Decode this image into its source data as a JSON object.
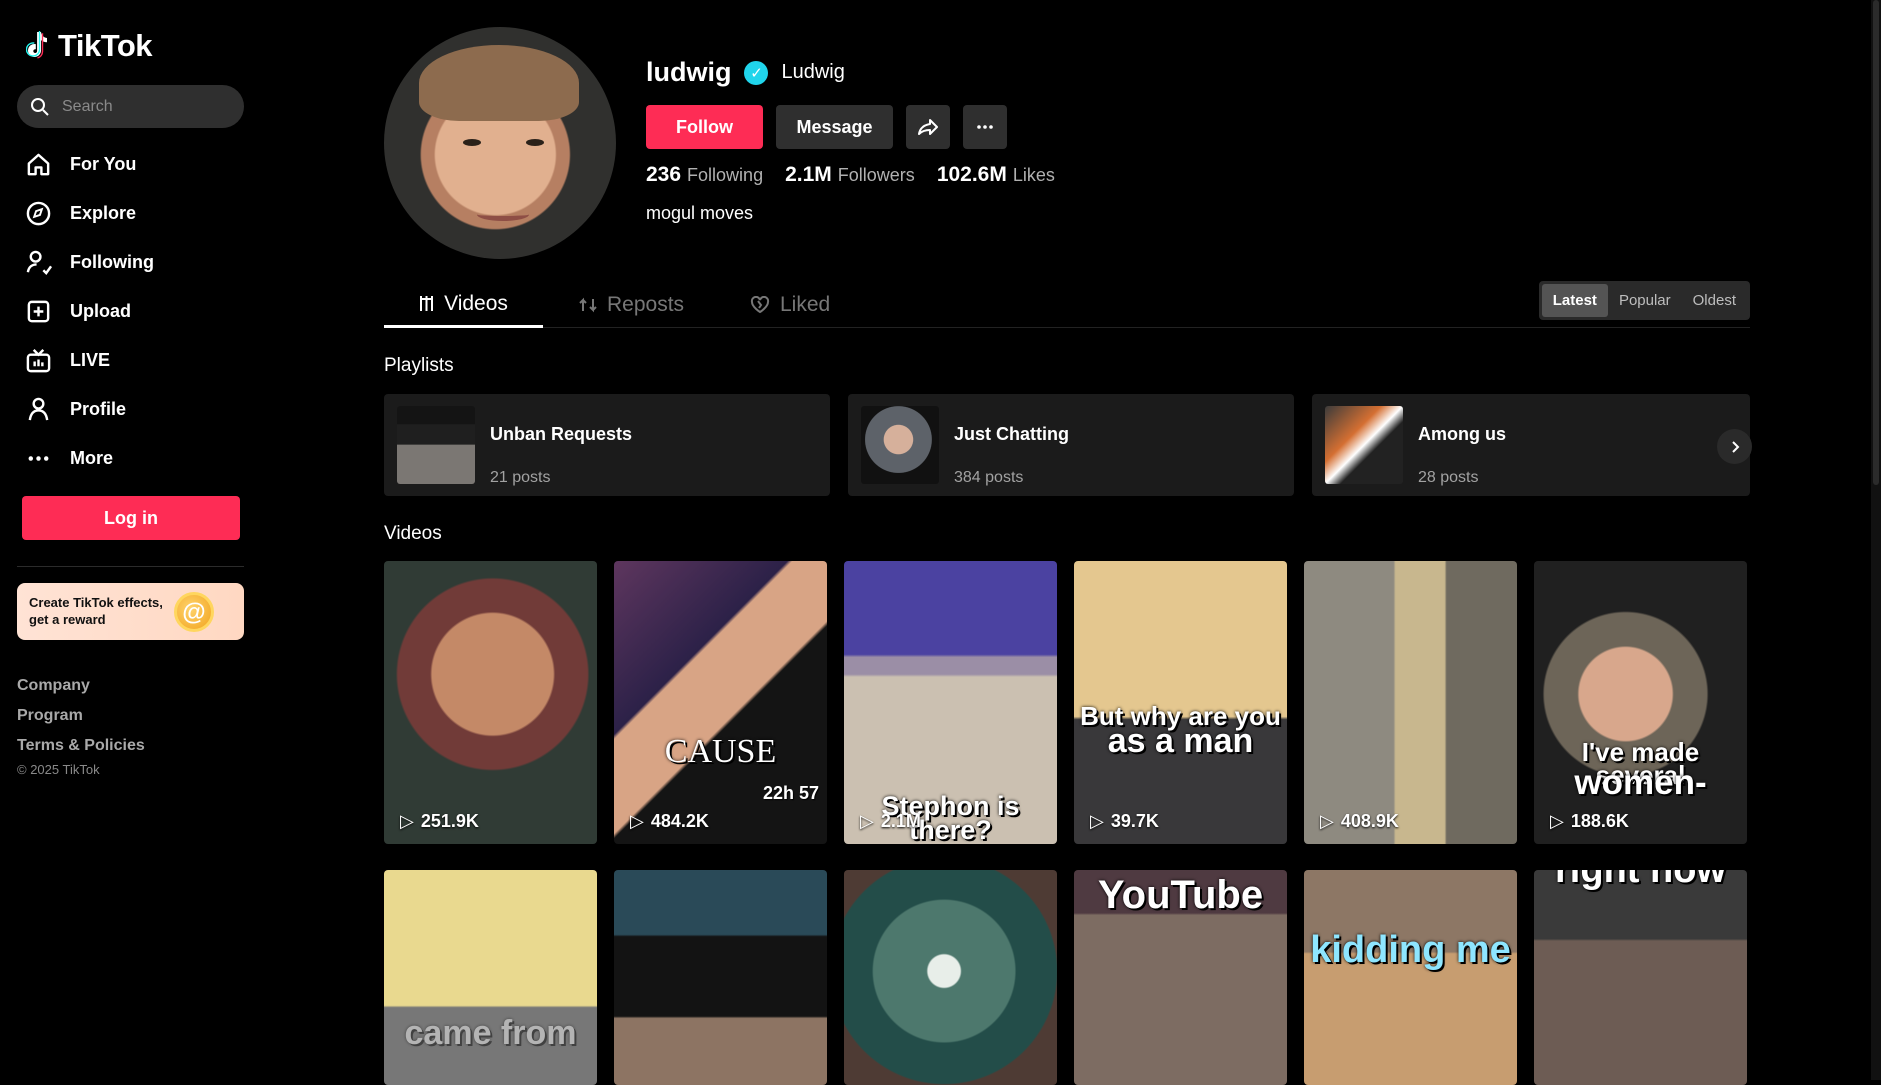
{
  "sidebar": {
    "logo": "TikTok",
    "search_placeholder": "Search",
    "items": [
      {
        "label": "For You",
        "icon": "home-icon"
      },
      {
        "label": "Explore",
        "icon": "compass-icon"
      },
      {
        "label": "Following",
        "icon": "following-icon"
      },
      {
        "label": "Upload",
        "icon": "plus-square-icon"
      },
      {
        "label": "LIVE",
        "icon": "live-icon"
      },
      {
        "label": "Profile",
        "icon": "person-icon"
      },
      {
        "label": "More",
        "icon": "more-icon"
      }
    ],
    "login": "Log in",
    "promo_line1": "Create TikTok effects,",
    "promo_line2": "get a reward",
    "footer": [
      "Company",
      "Program",
      "Terms & Policies"
    ],
    "copyright": "© 2025 TikTok"
  },
  "profile": {
    "username": "ludwig",
    "display_name": "Ludwig",
    "follow": "Follow",
    "message": "Message",
    "stats": [
      {
        "value": "236",
        "label": "Following"
      },
      {
        "value": "2.1M",
        "label": "Followers"
      },
      {
        "value": "102.6M",
        "label": "Likes"
      }
    ],
    "bio": "mogul moves"
  },
  "tabs": [
    "Videos",
    "Reposts",
    "Liked"
  ],
  "sort": [
    "Latest",
    "Popular",
    "Oldest"
  ],
  "sections": {
    "playlists": "Playlists",
    "videos": "Videos"
  },
  "playlists": [
    {
      "title": "Unban Requests",
      "posts": "21 posts"
    },
    {
      "title": "Just Chatting",
      "posts": "384 posts"
    },
    {
      "title": "Among us",
      "posts": "28 posts"
    }
  ],
  "videos": [
    {
      "views": "251.9K"
    },
    {
      "views": "484.2K",
      "time": "22h 57",
      "caption": "CAUSE"
    },
    {
      "views": "2.1M",
      "caption": "Stephon is there?"
    },
    {
      "views": "39.7K",
      "caption_top": "But why are you",
      "caption_bottom": "as a man"
    },
    {
      "views": "408.9K"
    },
    {
      "views": "188.6K",
      "caption_top": "I've made several",
      "caption_bottom": "women-"
    },
    {
      "caption": "came from"
    },
    {
      "caption": ""
    },
    {
      "caption": ""
    },
    {
      "caption": "YouTube"
    },
    {
      "caption": "kidding me"
    },
    {
      "caption": "right now"
    }
  ],
  "colors": {
    "accent": "#fe2c55",
    "verified": "#20d5ec",
    "background": "#000000"
  }
}
